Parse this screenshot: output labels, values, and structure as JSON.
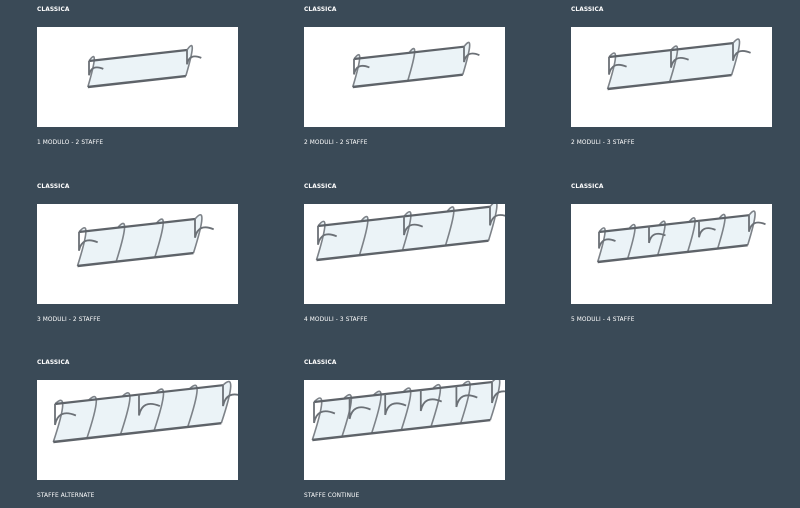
{
  "products": [
    {
      "category": "CLASSICA",
      "caption": "1 MODULO - 2 STAFFE",
      "icon": "canopy-1-module-image",
      "modules": 1,
      "brackets": 2
    },
    {
      "category": "CLASSICA",
      "caption": "2 MODULI - 2 STAFFE",
      "icon": "canopy-2-modules-image",
      "modules": 2,
      "brackets": 2
    },
    {
      "category": "CLASSICA",
      "caption": "2 MODULI - 3 STAFFE",
      "icon": "canopy-2-modules-3-brackets-image",
      "modules": 2,
      "brackets": 3
    },
    {
      "category": "CLASSICA",
      "caption": "3 MODULI - 2 STAFFE",
      "icon": "canopy-3-modules-image",
      "modules": 3,
      "brackets": 2
    },
    {
      "category": "CLASSICA",
      "caption": "4 MODULI - 3 STAFFE",
      "icon": "canopy-4-modules-image",
      "modules": 4,
      "brackets": 3
    },
    {
      "category": "CLASSICA",
      "caption": "5 MODULI - 4 STAFFE",
      "icon": "canopy-5-modules-image",
      "modules": 5,
      "brackets": 4
    },
    {
      "category": "CLASSICA",
      "caption": "STAFFE ALTERNATE",
      "icon": "canopy-alternate-brackets-image",
      "modules": 5,
      "brackets": 3
    },
    {
      "category": "CLASSICA",
      "caption": "STAFFE CONTINUE",
      "icon": "canopy-continuous-brackets-image",
      "modules": 6,
      "brackets": 6
    }
  ],
  "colors": {
    "background": "#3a4a57",
    "frame": "#7d8288",
    "glass": "#e3eef3"
  }
}
